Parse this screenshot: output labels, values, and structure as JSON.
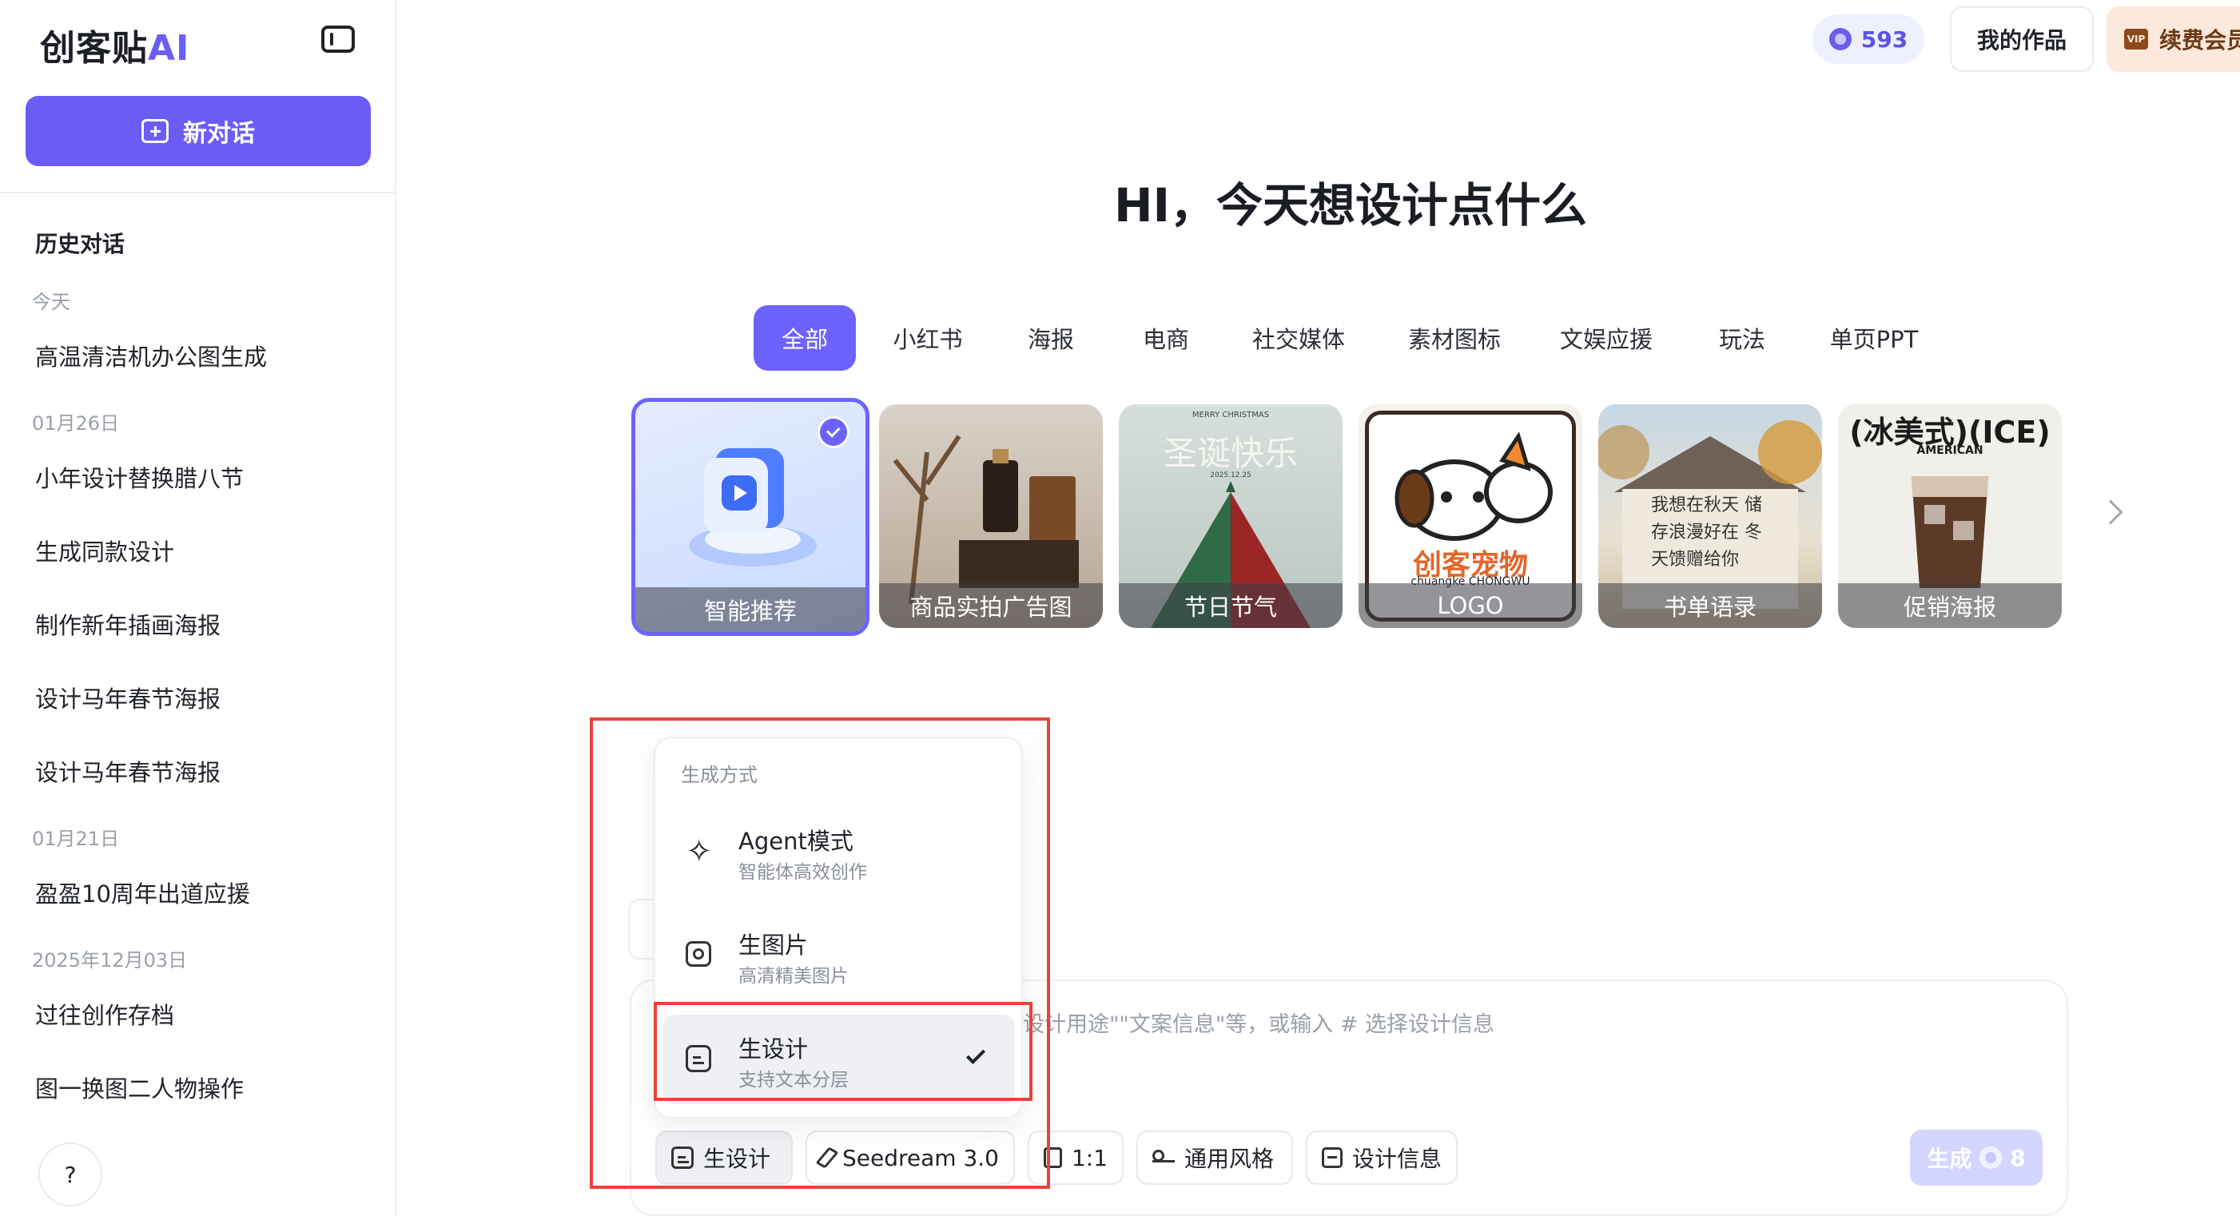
{
  "sidebar": {
    "logo_text": "创客贴",
    "logo_ai": "AI",
    "new_chat_label": "新对话",
    "history_title": "历史对话",
    "groups": [
      {
        "date": "今天",
        "items": [
          "高温清洁机办公图生成"
        ]
      },
      {
        "date": "01月26日",
        "items": [
          "小年设计替换腊八节",
          "生成同款设计",
          "制作新年插画海报",
          "设计马年春节海报",
          "设计马年春节海报"
        ]
      },
      {
        "date": "01月21日",
        "items": [
          "盈盈10周年出道应援"
        ]
      },
      {
        "date": "2025年12月03日",
        "items": [
          "过往创作存档",
          "图一换图二人物操作"
        ]
      }
    ],
    "help_label": "?"
  },
  "header": {
    "credits": "593",
    "my_works": "我的作品",
    "renew": "续费会员",
    "vip_badge": "VIP"
  },
  "hero": {
    "title": "HI，今天想设计点什么"
  },
  "tabs": [
    "全部",
    "小红书",
    "海报",
    "电商",
    "社交媒体",
    "素材图标",
    "文娱应援",
    "玩法",
    "单页PPT"
  ],
  "active_tab": "全部",
  "cards": [
    {
      "label": "智能推荐",
      "selected": true
    },
    {
      "label": "商品实拍广告图"
    },
    {
      "label": "节日节气",
      "art_text": "圣诞快乐",
      "art_small": "MERRY CHRISTMAS",
      "art_date": "2025.12.25"
    },
    {
      "label": "LOGO",
      "art_text": "创客宠物",
      "art_small": "chuangke CHONGWU"
    },
    {
      "label": "书单语录",
      "art_text": "我想在秋天 储存浪漫好在 冬天馈赠给你"
    },
    {
      "label": "促销海报",
      "art_text": "(冰美式)(ICE)",
      "art_small": "AMERICAN"
    }
  ],
  "dropdown": {
    "title": "生成方式",
    "items": [
      {
        "label": "Agent模式",
        "sub": "智能体高效创作",
        "icon": "sparkle-icon"
      },
      {
        "label": "生图片",
        "sub": "高清精美图片",
        "icon": "image-icon"
      },
      {
        "label": "生设计",
        "sub": "支持文本分层",
        "icon": "design-icon",
        "selected": true
      }
    ]
  },
  "composer": {
    "placeholder": "设计用途\"\"文案信息\"等，或输入 # 选择设计信息",
    "mode_label": "生设计",
    "model_label": "Seedream 3.0",
    "ratio_label": "1:1",
    "style_label": "通用风格",
    "info_label": "设计信息",
    "generate_label": "生成",
    "generate_cost": "8"
  },
  "colors": {
    "accent": "#6b5cf6",
    "highlight": "#e8423a"
  }
}
